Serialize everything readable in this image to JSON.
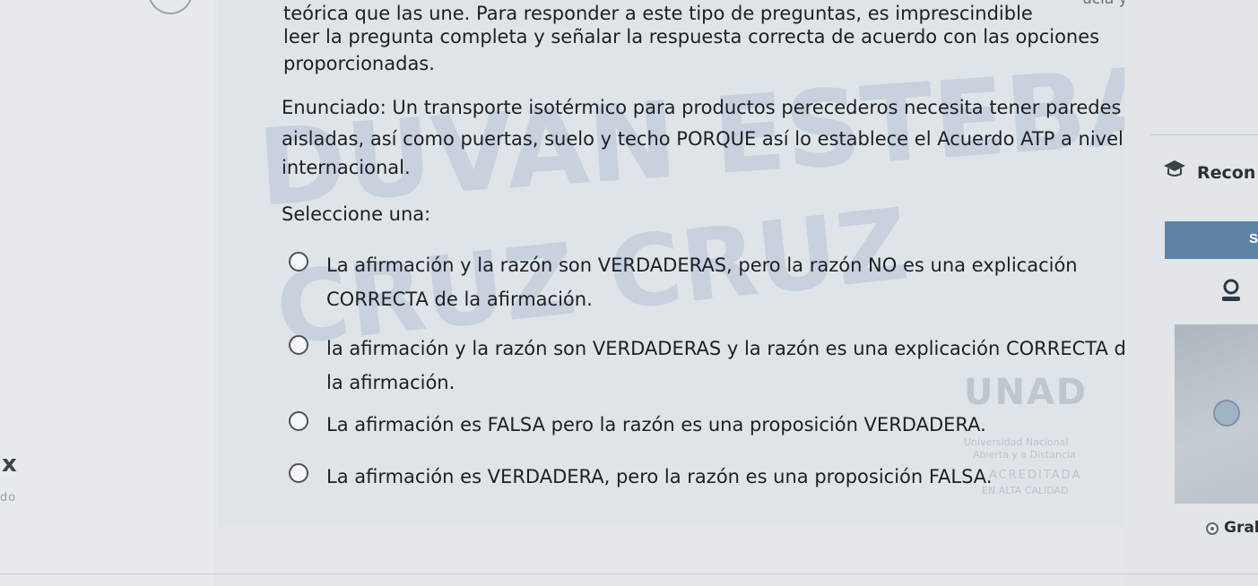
{
  "left": {
    "close_glyph": "x",
    "partial_text": "do"
  },
  "question": {
    "top_partial_right": "ucia y la",
    "line1": "teórica que las une. Para responder a este tipo de preguntas, es imprescindible",
    "line2": "leer la pregunta completa y señalar la respuesta correcta de acuerdo con las opciones",
    "line3": "proporcionadas.",
    "statement_line1": "Enunciado: Un transporte isotérmico para productos perecederos necesita tener paredes",
    "statement_line2": "aisladas, así como puertas, suelo y techo PORQUE así lo establece el Acuerdo ATP a nivel",
    "statement_line3": "internacional.",
    "select_label": "Seleccione una:"
  },
  "options": [
    {
      "line1": "La afirmación y la razón son VERDADERAS, pero la razón NO es una explicación",
      "line2": "CORRECTA de la afirmación."
    },
    {
      "line1": "la afirmación y la razón son VERDADERAS y la razón es una explicación CORRECTA de",
      "line2": "la afirmación."
    },
    {
      "line1": "La afirmación es FALSA pero la razón es una proposición VERDADERA.",
      "line2": ""
    },
    {
      "line1": "La afirmación es VERDADERA, pero la razón es una proposición FALSA.",
      "line2": ""
    }
  ],
  "watermarks": {
    "line1": "DUVAN ESTEBAN",
    "line2": "CRUZ CRUZ"
  },
  "logo": {
    "name": "UNAD",
    "sub1": "Universidad Nacional",
    "sub2": "Abierta y a Distancia",
    "sub3": "ACREDITADA",
    "sub4": "EN ALTA CALIDAD"
  },
  "sidebar": {
    "recon_label": "Recon",
    "button_label": "S",
    "grab_label": "Grab"
  },
  "colors": {
    "panel": "#dfe4e8",
    "button": "#5e82a6",
    "watermark": "#8ca0be"
  }
}
